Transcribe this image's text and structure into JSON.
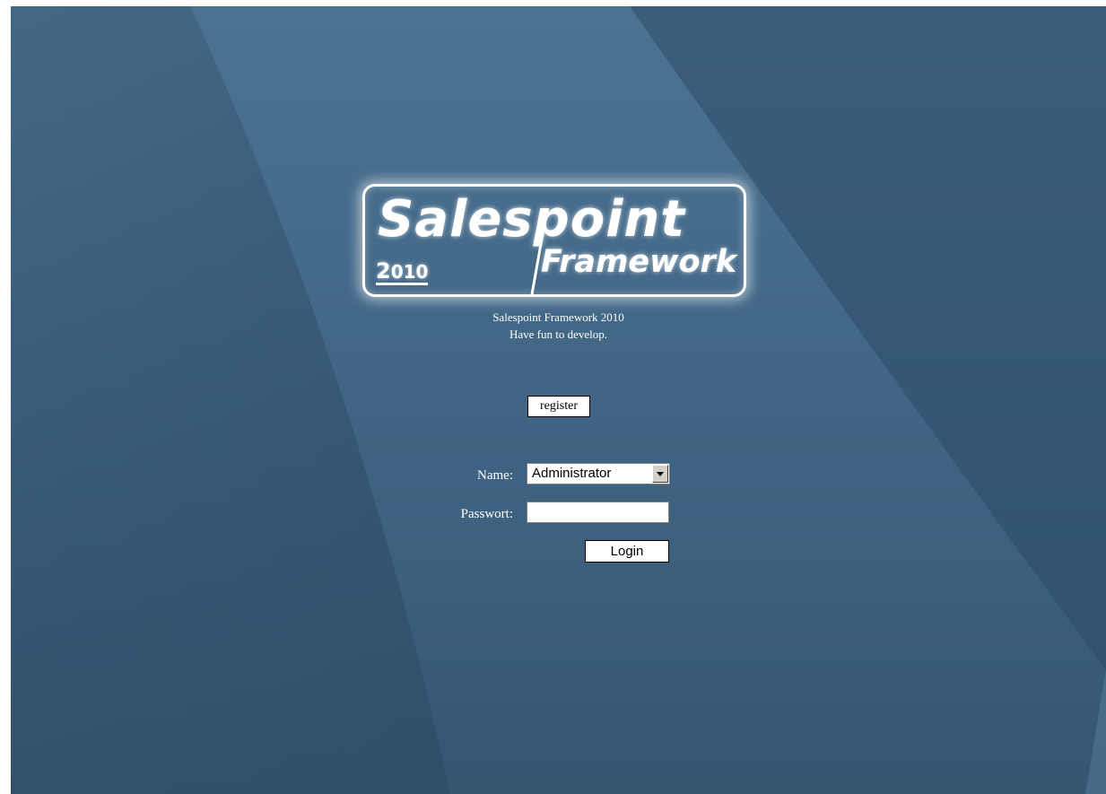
{
  "logo": {
    "word1": "Salespoint",
    "word2": "Framework",
    "year_first": "2",
    "year_rest": "010"
  },
  "intro": {
    "line1": "Salespoint Framework 2010",
    "line2": "Have fun to develop."
  },
  "register": {
    "label": "register"
  },
  "form": {
    "name_label": "Name:",
    "name_selected": "Administrator",
    "password_label": "Passwort:",
    "password_value": "",
    "login_label": "Login"
  },
  "colors": {
    "background": "#3d6180",
    "text": "#ffffff"
  }
}
